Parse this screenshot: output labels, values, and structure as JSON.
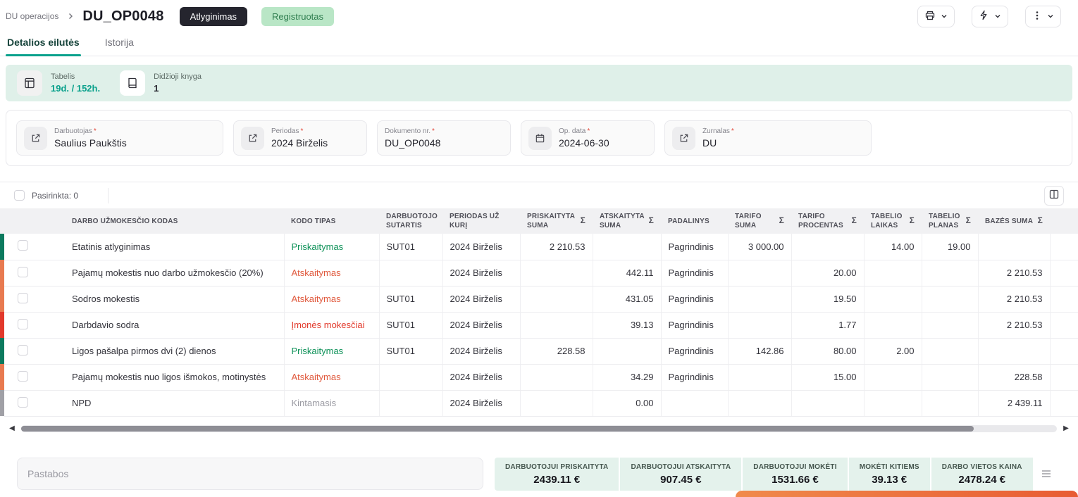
{
  "colors": {
    "accent_teal": "#0aa18c",
    "status_green": "#0d9158",
    "status_orange": "#e0593d",
    "status_red": "#e2392b",
    "status_gray": "#9a9aa2",
    "banner_bg": "#dff0e9",
    "summary_bg": "#e4f2ec",
    "badge_dark_bg": "#25252e",
    "badge_green_bg": "#b9e6c6",
    "toast_orange": "#e85c33"
  },
  "breadcrumb": {
    "root": "DU operacijos"
  },
  "header": {
    "title": "DU_OP0048",
    "type_badge": "Atlyginimas",
    "status_badge": "Registruotas"
  },
  "tabs": [
    {
      "label": "Detalios eilutės",
      "state": "active"
    },
    {
      "label": "Istorija",
      "state": "inactive"
    }
  ],
  "banner": {
    "items": [
      {
        "label": "Tabelis",
        "value": "19d. / 152h."
      },
      {
        "label": "Didžioji knyga",
        "value": "1"
      }
    ]
  },
  "fields": [
    {
      "label": "Darbuotojas",
      "required": "*",
      "value": "Saulius Paukštis"
    },
    {
      "label": "Periodas",
      "required": "*",
      "value": "2024 Birželis"
    },
    {
      "label": "Dokumento nr.",
      "required": "*",
      "value": "DU_OP0048"
    },
    {
      "label": "Op. data",
      "required": "*",
      "value": "2024-06-30"
    },
    {
      "label": "Žurnalas",
      "required": "*",
      "value": "DU"
    }
  ],
  "table": {
    "selected_label": "Pasirinkta: 0",
    "columns": [
      {
        "label": "DARBO UŽMOKESČIO KODAS",
        "sigma": ""
      },
      {
        "label": "KODO TIPAS",
        "sigma": ""
      },
      {
        "label": "DARBUOTOJO SUTARTIS",
        "sigma": ""
      },
      {
        "label": "PERIODAS UŽ KURĮ",
        "sigma": ""
      },
      {
        "label": "PRISKAITYTA SUMA",
        "sigma": "Σ"
      },
      {
        "label": "ATSKAITYTA SUMA",
        "sigma": "Σ"
      },
      {
        "label": "PADALINYS",
        "sigma": ""
      },
      {
        "label": "TARIFO SUMA",
        "sigma": "Σ"
      },
      {
        "label": "TARIFO PROCENTAS",
        "sigma": "Σ"
      },
      {
        "label": "TABELIO LAIKAS",
        "sigma": "Σ"
      },
      {
        "label": "TABELIO PLANAS",
        "sigma": "Σ"
      },
      {
        "label": "BAZĖS SUMA",
        "sigma": "Σ"
      }
    ],
    "rows": [
      {
        "tone": "green",
        "code": "Etatinis atlyginimas",
        "type": "Priskaitymas",
        "type_tone": "green",
        "contract": "SUT01",
        "period": "2024 Birželis",
        "accrued": "2 210.53",
        "deducted": "",
        "department": "Pagrindinis",
        "tariff_sum": "3 000.00",
        "tariff_pct": "",
        "timesheet_time": "14.00",
        "timesheet_plan": "19.00",
        "base_sum": ""
      },
      {
        "tone": "orange",
        "code": "Pajamų mokestis nuo darbo užmokesčio (20%)",
        "type": "Atskaitymas",
        "type_tone": "orange",
        "contract": "",
        "period": "2024 Birželis",
        "accrued": "",
        "deducted": "442.11",
        "department": "Pagrindinis",
        "tariff_sum": "",
        "tariff_pct": "20.00",
        "timesheet_time": "",
        "timesheet_plan": "",
        "base_sum": "2 210.53"
      },
      {
        "tone": "orange",
        "code": "Sodros mokestis",
        "type": "Atskaitymas",
        "type_tone": "orange",
        "contract": "SUT01",
        "period": "2024 Birželis",
        "accrued": "",
        "deducted": "431.05",
        "department": "Pagrindinis",
        "tariff_sum": "",
        "tariff_pct": "19.50",
        "timesheet_time": "",
        "timesheet_plan": "",
        "base_sum": "2 210.53"
      },
      {
        "tone": "red",
        "code": "Darbdavio sodra",
        "type": "Įmonės mokesčiai",
        "type_tone": "red",
        "contract": "SUT01",
        "period": "2024 Birželis",
        "accrued": "",
        "deducted": "39.13",
        "department": "Pagrindinis",
        "tariff_sum": "",
        "tariff_pct": "1.77",
        "timesheet_time": "",
        "timesheet_plan": "",
        "base_sum": "2 210.53"
      },
      {
        "tone": "green",
        "code": "Ligos pašalpa pirmos dvi (2) dienos",
        "type": "Priskaitymas",
        "type_tone": "green",
        "contract": "SUT01",
        "period": "2024 Birželis",
        "accrued": "228.58",
        "deducted": "",
        "department": "Pagrindinis",
        "tariff_sum": "142.86",
        "tariff_pct": "80.00",
        "timesheet_time": "2.00",
        "timesheet_plan": "",
        "base_sum": ""
      },
      {
        "tone": "orange",
        "code": "Pajamų mokestis nuo ligos išmokos, motinystės",
        "type": "Atskaitymas",
        "type_tone": "orange",
        "contract": "",
        "period": "2024 Birželis",
        "accrued": "",
        "deducted": "34.29",
        "department": "Pagrindinis",
        "tariff_sum": "",
        "tariff_pct": "15.00",
        "timesheet_time": "",
        "timesheet_plan": "",
        "base_sum": "228.58"
      },
      {
        "tone": "gray",
        "code": "NPD",
        "type": "Kintamasis",
        "type_tone": "gray",
        "contract": "",
        "period": "2024 Birželis",
        "accrued": "",
        "deducted": "0.00",
        "department": "",
        "tariff_sum": "",
        "tariff_pct": "",
        "timesheet_time": "",
        "timesheet_plan": "",
        "base_sum": "2 439.11"
      }
    ]
  },
  "notes": {
    "placeholder": "Pastabos"
  },
  "summary": [
    {
      "label": "DARBUOTOJUI PRISKAITYTA",
      "value": "2439.11 €"
    },
    {
      "label": "DARBUOTOJUI ATSKAITYTA",
      "value": "907.45 €"
    },
    {
      "label": "DARBUOTOJUI MOKĖTI",
      "value": "1531.66 €"
    },
    {
      "label": "MOKĖTI KITIEMS",
      "value": "39.13 €"
    },
    {
      "label": "DARBO VIETOS KAINA",
      "value": "2478.24 €"
    }
  ]
}
